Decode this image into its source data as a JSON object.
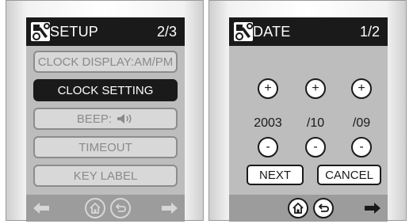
{
  "left_screen": {
    "title": "SETUP",
    "page": "2/3",
    "menu": [
      {
        "label": "CLOCK DISPLAY:AM/PM",
        "selected": false
      },
      {
        "label": "CLOCK SETTING",
        "selected": true
      },
      {
        "label": "BEEP:",
        "selected": false,
        "icon": "speaker-icon"
      },
      {
        "label": "TIMEOUT",
        "selected": false
      },
      {
        "label": "KEY LABEL",
        "selected": false
      }
    ],
    "nav": {
      "back_icon": "left-arrow-icon",
      "home_icon": "home-icon",
      "return_icon": "return-icon",
      "forward_icon": "right-arrow-icon",
      "arrows_enabled": false
    }
  },
  "right_screen": {
    "title": "DATE",
    "page": "1/2",
    "increment_label": "+",
    "decrement_label": "-",
    "year": "2003",
    "month": "/10",
    "day": "/09",
    "next_label": "NEXT",
    "cancel_label": "CANCEL",
    "nav": {
      "home_icon": "home-icon",
      "return_icon": "return-icon",
      "forward_icon": "right-arrow-icon"
    }
  },
  "colors": {
    "title_bar": "#1a1a1a",
    "screen_bg": "#bdbdbd",
    "disabled_text": "#8a8a8a",
    "bottom_bar": "#9c9c9c"
  }
}
